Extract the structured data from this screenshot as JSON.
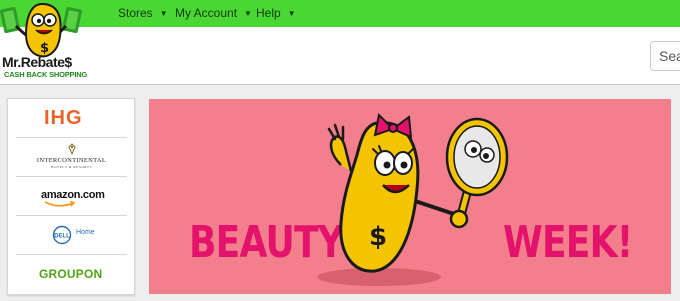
{
  "nav": {
    "items": [
      {
        "label": "Stores"
      },
      {
        "label": "My Account"
      },
      {
        "label": "Help"
      }
    ]
  },
  "logo": {
    "name": "Mr.Rebate$",
    "tagline": "CASH BACK SHOPPING"
  },
  "search": {
    "placeholder": "Search"
  },
  "stores": {
    "items": [
      {
        "name": "IHG"
      },
      {
        "name": "INTERCONTINENTAL",
        "sub": "HOTELS & RESORTS"
      },
      {
        "name": "amazon.com"
      },
      {
        "name": "Home",
        "brand": "DELL"
      },
      {
        "name": "GROUPON"
      }
    ]
  },
  "banner": {
    "left_word": "BEAUTY",
    "right_word": "WEEK!"
  },
  "colors": {
    "nav_green": "#4ad633",
    "banner_pink": "#f47f8c",
    "banner_text": "#e3126a",
    "mascot_yellow": "#f5c400"
  }
}
